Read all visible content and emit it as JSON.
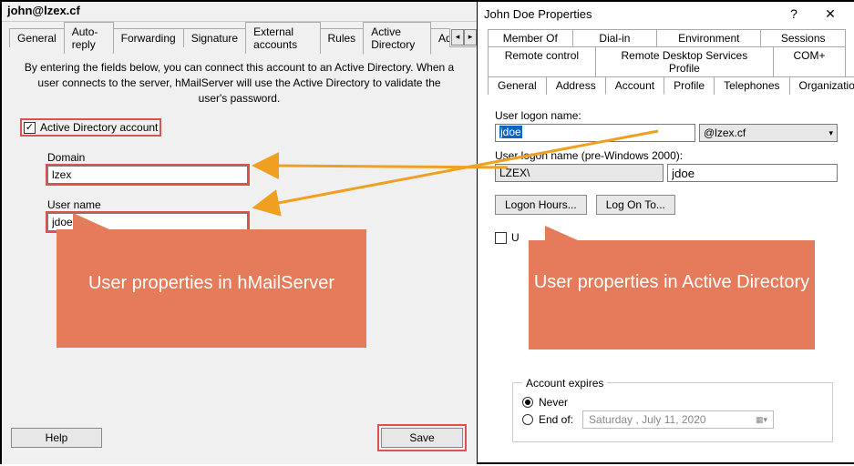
{
  "left": {
    "title": "john@lzex.cf",
    "tabs": [
      "General",
      "Auto-reply",
      "Forwarding",
      "Signature",
      "External accounts",
      "Rules",
      "Active Directory",
      "Adv"
    ],
    "active_tab_index": 6,
    "help_text": "By entering the fields below, you can connect this account to an Active Directory. When a user connects to the server, hMailServer will use the Active Directory to validate the user's password.",
    "checkbox_label": "Active Directory account",
    "checkbox_checked": true,
    "domain_label": "Domain",
    "domain_value": "lzex",
    "username_label": "User name",
    "username_value": "jdoe",
    "callout": "User properties in hMailServer",
    "help_btn": "Help",
    "save_btn": "Save"
  },
  "right": {
    "title": "John Doe Properties",
    "tabs_row1": [
      "Member Of",
      "Dial-in",
      "Environment",
      "Sessions"
    ],
    "tabs_row2": [
      "Remote control",
      "Remote Desktop Services Profile",
      "COM+"
    ],
    "tabs_row3": [
      "General",
      "Address",
      "Account",
      "Profile",
      "Telephones",
      "Organization"
    ],
    "active_tab": "Account",
    "logon_label": "User logon name:",
    "logon_value": "jdoe",
    "domain_suffix": "@lzex.cf",
    "prewin_label": "User logon name (pre-Windows 2000):",
    "prewin_prefix": "LZEX\\",
    "prewin_user": "jdoe",
    "logon_hours_btn": "Logon Hours...",
    "logon_to_btn": "Log On To...",
    "unlock_partial": "U",
    "callout": "User properties in Active Directory",
    "expires_legend": "Account expires",
    "never_label": "Never",
    "endof_label": "End of:",
    "endof_date": "Saturday ,      July     11, 2020"
  }
}
